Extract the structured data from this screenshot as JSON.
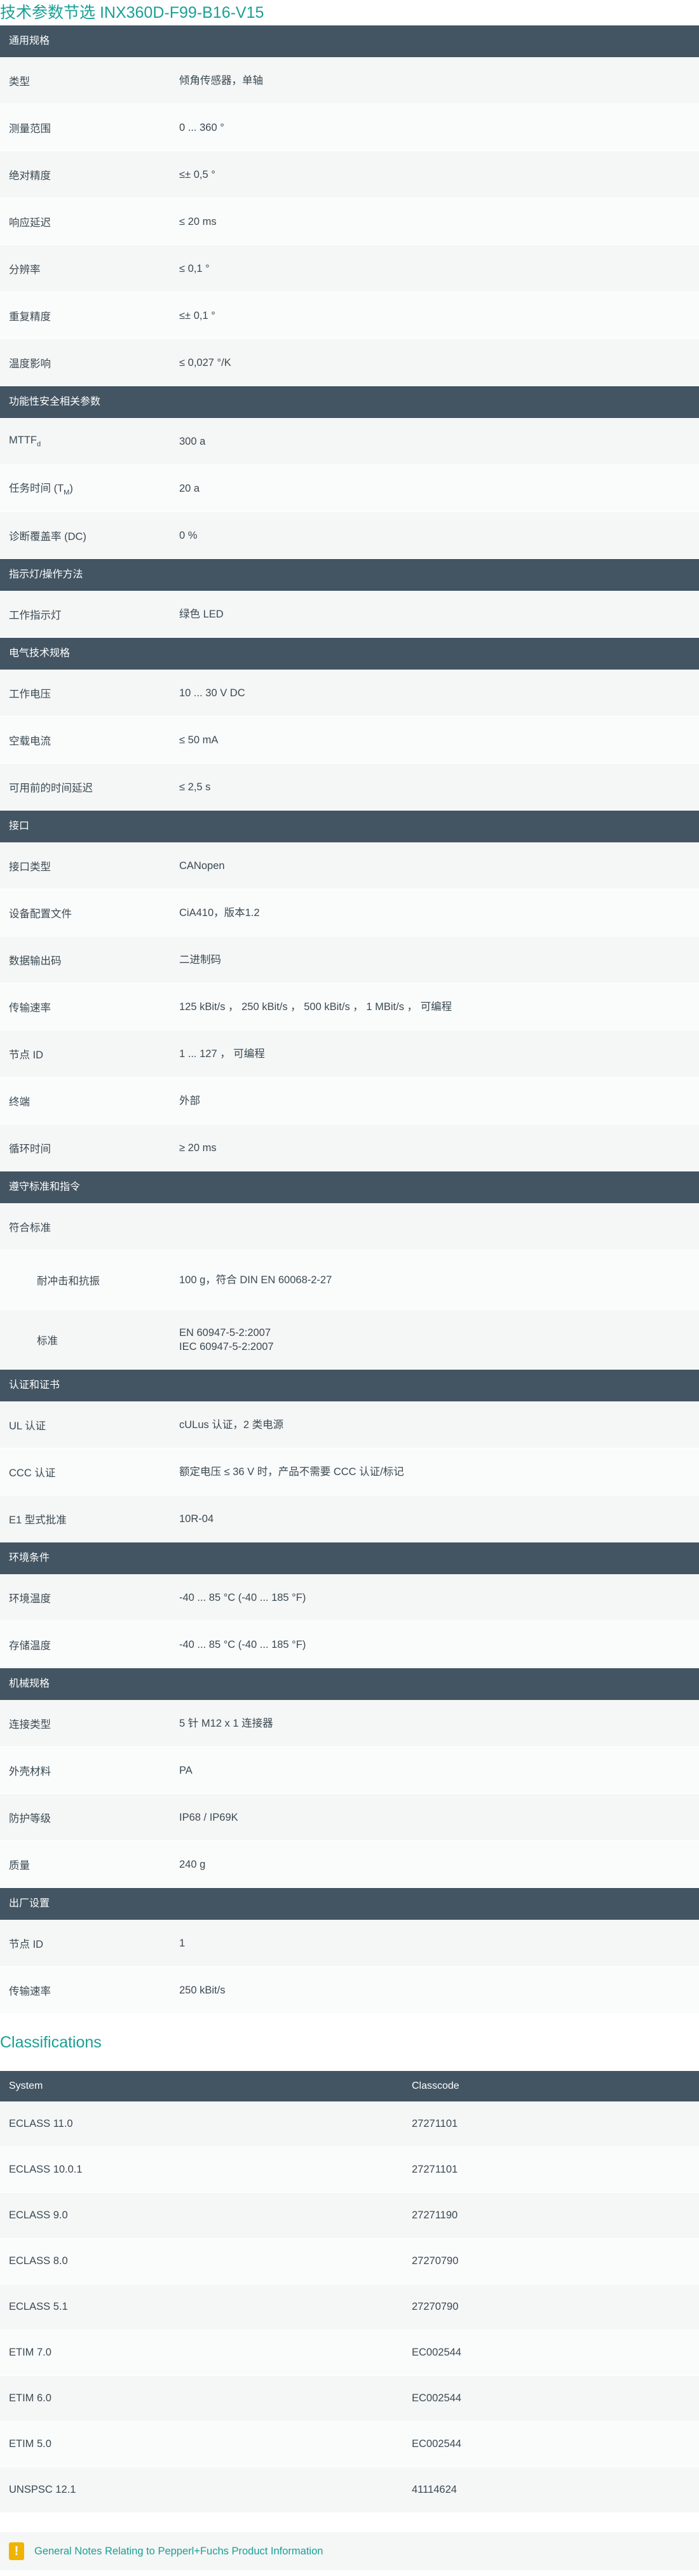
{
  "title": "技术参数节选  INX360D-F99-B16-V15",
  "sections": [
    {
      "heading": "通用规格",
      "rows": [
        {
          "label": "类型",
          "value": "倾角传感器，单轴"
        },
        {
          "label": "测量范围",
          "value": "0 ... 360 °"
        },
        {
          "label": "绝对精度",
          "value": "≤± 0,5 °"
        },
        {
          "label": "响应延迟",
          "value": "≤ 20 ms"
        },
        {
          "label": "分辨率",
          "value": "≤ 0,1 °"
        },
        {
          "label": "重复精度",
          "value": "≤± 0,1 °"
        },
        {
          "label": "温度影响",
          "value": "≤ 0,027 °/K"
        }
      ]
    },
    {
      "heading": "功能性安全相关参数",
      "rows": [
        {
          "label": "MTTF",
          "sub": "d",
          "label_after": "",
          "value": "300 a"
        },
        {
          "label": "任务时间 (T",
          "sub": "M",
          "label_after": ")",
          "value": "20 a"
        },
        {
          "label": "诊断覆盖率 (DC)",
          "value": "0 %"
        }
      ]
    },
    {
      "heading": "指示灯/操作方法",
      "rows": [
        {
          "label": "工作指示灯",
          "value": "绿色 LED"
        }
      ]
    },
    {
      "heading": "电气技术规格",
      "rows": [
        {
          "label": "工作电压",
          "value": "10 ... 30 V DC"
        },
        {
          "label": "空载电流",
          "value": "≤ 50 mA"
        },
        {
          "label": "可用前的时间延迟",
          "value": "≤ 2,5 s"
        }
      ]
    },
    {
      "heading": "接口",
      "rows": [
        {
          "label": "接口类型",
          "value": "CANopen"
        },
        {
          "label": "设备配置文件",
          "value": "CiA410，版本1.2"
        },
        {
          "label": "数据输出码",
          "value": "二进制码"
        },
        {
          "label": "传输速率",
          "value": "125 kBit/s ，  250 kBit/s ，  500 kBit/s ，  1 MBit/s ，  可编程"
        },
        {
          "label": "节点 ID",
          "value": "1 ... 127 ，  可编程"
        },
        {
          "label": "终端",
          "value": "外部"
        },
        {
          "label": "循环时间",
          "value": "≥ 20 ms"
        }
      ]
    },
    {
      "heading": "遵守标准和指令",
      "rows": [
        {
          "label": "符合标准",
          "value": "",
          "short": true
        },
        {
          "label": "耐冲击和抗振",
          "value": "100 g，符合 DIN EN 60068-2-27",
          "indent": true,
          "tall": true
        },
        {
          "label": "标准",
          "value": "EN 60947-5-2:2007",
          "value2": "IEC 60947-5-2:2007",
          "indent": true,
          "tall": true
        }
      ]
    },
    {
      "heading": "认证和证书",
      "rows": [
        {
          "label": "UL 认证",
          "value": "cULus 认证，2 类电源"
        },
        {
          "label": "CCC 认证",
          "value": "额定电压 ≤ 36 V 时，产品不需要 CCC 认证/标记"
        },
        {
          "label": "E1 型式批准",
          "value": "10R-04"
        }
      ]
    },
    {
      "heading": "环境条件",
      "rows": [
        {
          "label": "环境温度",
          "value": "-40 ... 85 °C (-40 ... 185 °F)"
        },
        {
          "label": "存储温度",
          "value": "-40 ... 85 °C (-40 ... 185 °F)"
        }
      ]
    },
    {
      "heading": "机械规格",
      "rows": [
        {
          "label": "连接类型",
          "value": "5 针 M12 x 1 连接器"
        },
        {
          "label": "外壳材料",
          "value": "PA"
        },
        {
          "label": "防护等级",
          "value": "IP68 / IP69K"
        },
        {
          "label": "质量",
          "value": "240 g"
        }
      ]
    },
    {
      "heading": "出厂设置",
      "rows": [
        {
          "label": "节点 ID",
          "value": "1"
        },
        {
          "label": "传输速率",
          "value": "250 kBit/s"
        }
      ]
    }
  ],
  "classifications": {
    "title": "Classifications",
    "columns": [
      "System",
      "Classcode"
    ],
    "rows": [
      [
        "ECLASS 11.0",
        "27271101"
      ],
      [
        "ECLASS 10.0.1",
        "27271101"
      ],
      [
        "ECLASS 9.0",
        "27271190"
      ],
      [
        "ECLASS 8.0",
        "27270790"
      ],
      [
        "ECLASS 5.1",
        "27270790"
      ],
      [
        "ETIM 7.0",
        "EC002544"
      ],
      [
        "ETIM 6.0",
        "EC002544"
      ],
      [
        "ETIM 5.0",
        "EC002544"
      ],
      [
        "UNSPSC 12.1",
        "41114624"
      ]
    ]
  },
  "notes": {
    "icon": "warning-icon",
    "icon_glyph": "!",
    "link_text": "General Notes Relating to Pepperl+Fuchs Product Information",
    "accent": "#1aa095",
    "icon_color": "#f0b400"
  },
  "colors": {
    "header_bg": "#435563",
    "accent": "#1aa095"
  }
}
